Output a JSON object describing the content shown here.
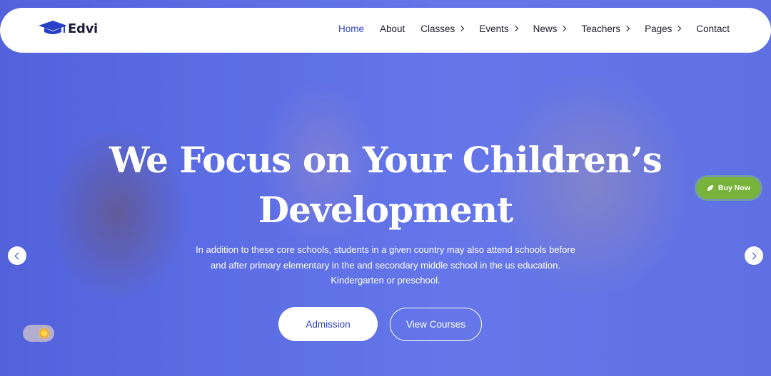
{
  "brand": {
    "name": "Edvi",
    "accent": "#2a3fc7"
  },
  "nav": {
    "items": [
      {
        "label": "Home",
        "active": true,
        "has_dropdown": false
      },
      {
        "label": "About",
        "active": false,
        "has_dropdown": false
      },
      {
        "label": "Classes",
        "active": false,
        "has_dropdown": true
      },
      {
        "label": "Events",
        "active": false,
        "has_dropdown": true
      },
      {
        "label": "News",
        "active": false,
        "has_dropdown": true
      },
      {
        "label": "Teachers",
        "active": false,
        "has_dropdown": true
      },
      {
        "label": "Pages",
        "active": false,
        "has_dropdown": true
      },
      {
        "label": "Contact",
        "active": false,
        "has_dropdown": false
      }
    ]
  },
  "hero": {
    "title_line1": "We Focus on Your Children’s",
    "title_line2": "Development",
    "desc_line1": "In addition to these core schools, students in a given country may also attend schools before",
    "desc_line2": "and after primary elementary in the and secondary middle school in the us education.",
    "desc_line3": "Kindergarten or preschool.",
    "primary_button": "Admission",
    "secondary_button": "View Courses"
  },
  "slider": {
    "prev_icon": "chevron-left-icon",
    "next_icon": "chevron-right-icon"
  },
  "buy_now": {
    "label": "Buy Now",
    "color": "#78b43c",
    "icon": "leaf-icon"
  },
  "theme_toggle": {
    "icon": "sun-icon"
  }
}
